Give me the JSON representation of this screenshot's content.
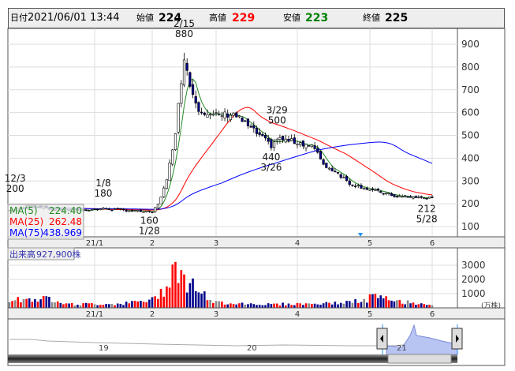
{
  "header": {
    "date_label": "日付",
    "date": "2021/06/01 13:44",
    "open_label": "始値",
    "open": "224",
    "high_label": "高値",
    "high": "229",
    "low_label": "安値",
    "low": "223",
    "close_label": "終値",
    "close": "225"
  },
  "colors": {
    "up": "#ff0000",
    "down": "#00008b",
    "flat": "#888888",
    "ma5": "#228b22",
    "ma25": "#ff0000",
    "ma75": "#0000ff",
    "low_text": "#008000"
  },
  "legend": {
    "ma5_label": "MA(5)",
    "ma5": "224.40",
    "ma25_label": "MA(25)",
    "ma25": "262.48",
    "ma75_label": "MA(75)",
    "ma75": "438.969"
  },
  "volume": {
    "label": "出来高",
    "value": "927,900株",
    "unit": "(万株)"
  },
  "navigator": {
    "year_labels": [
      "19",
      "20",
      "21"
    ]
  },
  "chart_data": {
    "type": "candlestick",
    "price_axis": {
      "ticks": [
        100,
        200,
        300,
        400,
        500,
        600,
        700,
        800,
        900
      ],
      "ylim": [
        70,
        960
      ]
    },
    "month_ticks": [
      "21/1",
      "2",
      "3",
      "4",
      "5",
      "6"
    ],
    "month_tick_days": [
      30,
      50,
      72,
      100,
      125,
      148
    ],
    "days": 149,
    "close_keyframes": [
      [
        0,
        170
      ],
      [
        8,
        195
      ],
      [
        15,
        175
      ],
      [
        25,
        172
      ],
      [
        33,
        178
      ],
      [
        45,
        168
      ],
      [
        50,
        162
      ],
      [
        52,
        200
      ],
      [
        55,
        300
      ],
      [
        58,
        520
      ],
      [
        61,
        850
      ],
      [
        63,
        720
      ],
      [
        66,
        620
      ],
      [
        70,
        585
      ],
      [
        78,
        595
      ],
      [
        85,
        520
      ],
      [
        91,
        455
      ],
      [
        93,
        485
      ],
      [
        100,
        470
      ],
      [
        105,
        455
      ],
      [
        110,
        360
      ],
      [
        113,
        345
      ],
      [
        118,
        290
      ],
      [
        125,
        262
      ],
      [
        135,
        232
      ],
      [
        148,
        225
      ]
    ],
    "volume_keyframes": [
      [
        0,
        600
      ],
      [
        15,
        650
      ],
      [
        22,
        250
      ],
      [
        40,
        300
      ],
      [
        50,
        550
      ],
      [
        54,
        1300
      ],
      [
        58,
        3300
      ],
      [
        61,
        1800
      ],
      [
        64,
        1700
      ],
      [
        67,
        1100
      ],
      [
        70,
        400
      ],
      [
        90,
        250
      ],
      [
        110,
        300
      ],
      [
        124,
        500
      ],
      [
        125,
        850
      ],
      [
        135,
        450
      ],
      [
        148,
        250
      ]
    ],
    "volume_axis": {
      "ticks": [
        1000,
        2000,
        3000
      ],
      "ylim": [
        0,
        4200
      ]
    },
    "annotations": [
      {
        "text": "12/3",
        "day": 2,
        "price": 200,
        "pos": "above"
      },
      {
        "text": "200",
        "day": 2,
        "price": 200,
        "pos": "above2"
      },
      {
        "text": "1/8",
        "day": 33,
        "price": 180,
        "pos": "above"
      },
      {
        "text": "180",
        "day": 33,
        "price": 180,
        "pos": "above2"
      },
      {
        "text": "160",
        "day": 49,
        "price": 160,
        "pos": "below"
      },
      {
        "text": "1/28",
        "day": 49,
        "price": 160,
        "pos": "below2"
      },
      {
        "text": "2/15",
        "day": 61,
        "price": 880,
        "pos": "above"
      },
      {
        "text": "880",
        "day": 61,
        "price": 880,
        "pos": "above2"
      },
      {
        "text": "3/29",
        "day": 93,
        "price": 500,
        "pos": "above"
      },
      {
        "text": "500",
        "day": 93,
        "price": 500,
        "pos": "above2"
      },
      {
        "text": "440",
        "day": 91,
        "price": 440,
        "pos": "below"
      },
      {
        "text": "3/26",
        "day": 91,
        "price": 440,
        "pos": "below2"
      },
      {
        "text": "212",
        "day": 146,
        "price": 212,
        "pos": "below"
      },
      {
        "text": "5/28",
        "day": 146,
        "price": 212,
        "pos": "below2"
      }
    ]
  }
}
